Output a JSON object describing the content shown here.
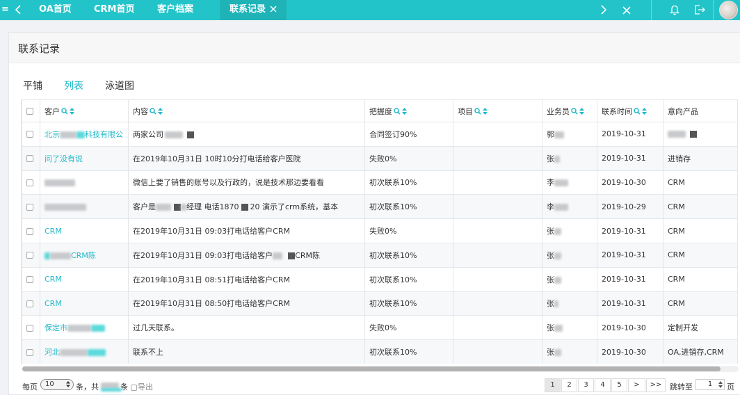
{
  "topbar": {
    "tabs": [
      {
        "label": "OA首页"
      },
      {
        "label": "CRM首页"
      },
      {
        "label": "客户档案"
      },
      {
        "label": "联系记录",
        "active": true
      }
    ],
    "menu_icon": "≡",
    "icons": [
      "hamburger-icon",
      "chevron-left-icon",
      "chevron-right-icon",
      "close-icon",
      "bell-icon",
      "logout-icon",
      "avatar"
    ],
    "colors": {
      "bar": "#22c4c9",
      "active_tab": "#1fb3b8"
    }
  },
  "panel": {
    "title": "联系记录"
  },
  "view_tabs": [
    {
      "label": "平铺"
    },
    {
      "label": "列表",
      "active": true
    },
    {
      "label": "泳道图"
    }
  ],
  "table": {
    "columns": [
      "客户",
      "内容",
      "把握度",
      "项目",
      "业务员",
      "联系时间",
      "意向产品"
    ],
    "rows": [
      {
        "customer": "北京",
        "customer_tail": "科技有限公",
        "content": "两家公司",
        "confidence": "合同签订90%",
        "project": "",
        "salesperson": "郭",
        "date": "2019-10-31",
        "product": ""
      },
      {
        "customer": "问了没有说",
        "customer_tail": "",
        "content": "在2019年10月31日 10时10分打电话给客户医院",
        "confidence": "失败0%",
        "project": "",
        "salesperson": "张",
        "date": "2019-10-31",
        "product": "进销存"
      },
      {
        "customer": "",
        "customer_tail": "",
        "content": "微信上要了销售的账号以及行政的，说是技术那边要看看",
        "confidence": "初次联系10%",
        "project": "",
        "salesperson": "李",
        "date": "2019-10-30",
        "product": "CRM"
      },
      {
        "customer": "",
        "customer_tail": "",
        "content": "客户是",
        "content_mid": "经理 电话1870",
        "content_tail": "20 演示了crm系统，基本",
        "confidence": "初次联系10%",
        "project": "",
        "salesperson": "李",
        "date": "2019-10-29",
        "product": "CRM"
      },
      {
        "customer": "CRM",
        "customer_tail": "",
        "content": "在2019年10月31日 09:03打电话给客户CRM",
        "confidence": "失败0%",
        "project": "",
        "salesperson": "张",
        "date": "2019-10-31",
        "product": "CRM"
      },
      {
        "customer": "",
        "customer_tail": "CRM陈",
        "content": "在2019年10月31日 09:03打电话给客户",
        "content_tail": "CRM陈",
        "confidence": "初次联系10%",
        "project": "",
        "salesperson": "张",
        "date": "2019-10-31",
        "product": "CRM"
      },
      {
        "customer": "CRM",
        "customer_tail": "",
        "content": "在2019年10月31日 08:51打电话给客户CRM",
        "confidence": "初次联系10%",
        "project": "",
        "salesperson": "张",
        "date": "2019-10-31",
        "product": "CRM"
      },
      {
        "customer": "CRM",
        "customer_tail": "",
        "content": "在2019年10月31日 08:50打电话给客户CRM",
        "confidence": "初次联系10%",
        "project": "",
        "salesperson": "张",
        "date": "2019-10-31",
        "product": "CRM"
      },
      {
        "customer": "保定市",
        "customer_tail": "",
        "content": "过几天联系。",
        "confidence": "失败0%",
        "project": "",
        "salesperson": "张",
        "date": "2019-10-30",
        "product": "定制开发"
      },
      {
        "customer": "河北",
        "customer_tail": "",
        "content": "联系不上",
        "confidence": "初次联系10%",
        "project": "",
        "salesperson": "张",
        "date": "2019-10-30",
        "product": "OA,进销存,CRM"
      }
    ]
  },
  "pager": {
    "per_page_label": "每页",
    "per_page_value": "10",
    "unit_label": "条，",
    "total_prefix": "共",
    "total_suffix": "条",
    "export_label": "导出",
    "pages": [
      "1",
      "2",
      "3",
      "4",
      "5",
      ">",
      ">>"
    ],
    "current_page": "1",
    "jump_label": "跳转至",
    "jump_value": "1",
    "page_suffix": "页"
  },
  "accent_color": "#21b8c9"
}
